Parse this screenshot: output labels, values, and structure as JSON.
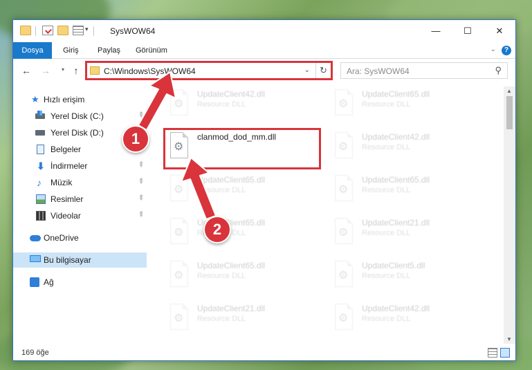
{
  "window": {
    "title": "SysWOW64",
    "minimize": "—",
    "maximize": "☐",
    "close": "✕"
  },
  "ribbon": {
    "tabs": [
      "Dosya",
      "Giriş",
      "Paylaş",
      "Görünüm"
    ]
  },
  "nav": {
    "back": "←",
    "forward": "→",
    "recent": "▾",
    "up": "↑",
    "address": "C:\\Windows\\SysWOW64",
    "refresh": "↻",
    "search_placeholder": "Ara: SysWOW64"
  },
  "sidebar": {
    "items": [
      {
        "label": "Hızlı erişim",
        "icon": "star-icon"
      },
      {
        "label": "Yerel Disk (C:)",
        "icon": "drive-c-icon",
        "pinned": true
      },
      {
        "label": "Yerel Disk (D:)",
        "icon": "drive-d-icon",
        "pinned": true
      },
      {
        "label": "Belgeler",
        "icon": "documents-icon",
        "pinned": true
      },
      {
        "label": "İndirmeler",
        "icon": "downloads-icon",
        "pinned": true
      },
      {
        "label": "Müzik",
        "icon": "music-icon",
        "pinned": true
      },
      {
        "label": "Resimler",
        "icon": "pictures-icon",
        "pinned": true
      },
      {
        "label": "Videolar",
        "icon": "videos-icon",
        "pinned": true
      },
      {
        "label": "OneDrive",
        "icon": "onedrive-icon"
      },
      {
        "label": "Bu bilgisayar",
        "icon": "this-pc-icon",
        "selected": true
      },
      {
        "label": "Ağ",
        "icon": "network-icon"
      }
    ]
  },
  "files": {
    "highlighted": {
      "name": "clanmod_dod_mm.dll",
      "type": ""
    },
    "left_column": [
      {
        "name": "UpdateClient42.dll",
        "type": "Resource DLL"
      },
      {
        "name": "UpdateClient65.dll",
        "type": "Resource DLL"
      },
      {
        "name": "UpdateClient65.dll",
        "type": "Resource DLL"
      },
      {
        "name": "UpdateClient65.dll",
        "type": "Resource DLL"
      },
      {
        "name": "UpdateClient21.dll",
        "type": "Resource DLL"
      }
    ],
    "right_column": [
      {
        "name": "UpdateClient65.dll",
        "type": "Resource DLL"
      },
      {
        "name": "UpdateClient42.dll",
        "type": "Resource DLL"
      },
      {
        "name": "UpdateClient65.dll",
        "type": "Resource DLL"
      },
      {
        "name": "UpdateClient21.dll",
        "type": "Resource DLL"
      },
      {
        "name": "UpdateClient5.dll",
        "type": "Resource DLL"
      },
      {
        "name": "UpdateClient42.dll",
        "type": "Resource DLL"
      }
    ]
  },
  "status": {
    "item_count": "169 öğe"
  },
  "annotations": {
    "step1": "1",
    "step2": "2",
    "color": "#d9343b"
  }
}
